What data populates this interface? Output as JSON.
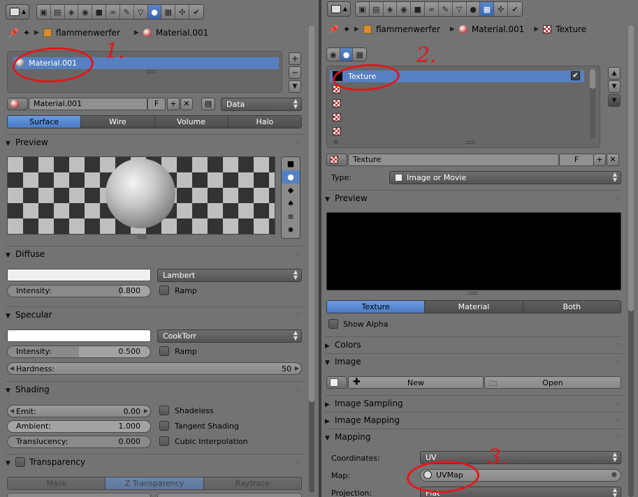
{
  "left": {
    "breadcrumb": {
      "object": "flammenwerfer",
      "material": "Material.001"
    },
    "slot_list": {
      "selected": "Material.001"
    },
    "datablock": {
      "name": "Material.001",
      "fake_user": "F",
      "link": "Data"
    },
    "tabs": [
      "Surface",
      "Wire",
      "Volume",
      "Halo"
    ],
    "preview": {
      "title": "Preview"
    },
    "diffuse": {
      "title": "Diffuse",
      "shader": "Lambert",
      "intensity_label": "Intensity:",
      "intensity_value": "0.800",
      "intensity": 0.8,
      "ramp": "Ramp",
      "color": "#f0f0f0"
    },
    "specular": {
      "title": "Specular",
      "shader": "CookTorr",
      "intensity_label": "Intensity:",
      "intensity_value": "0.500",
      "intensity": 0.5,
      "ramp": "Ramp",
      "hardness_label": "Hardness:",
      "hardness_value": "50",
      "color": "#ffffff"
    },
    "shading": {
      "title": "Shading",
      "emit_label": "Emit:",
      "emit_value": "0.00",
      "ambient_label": "Ambient:",
      "ambient_value": "1.000",
      "translucency_label": "Translucency:",
      "translucency_value": "0.000",
      "shadeless": "Shadeless",
      "tangent": "Tangent Shading",
      "cubic": "Cubic Interpolation"
    },
    "transparency": {
      "title": "Transparency",
      "tabs": [
        "Mask",
        "Z Transparency",
        "Raytrace"
      ]
    }
  },
  "right": {
    "breadcrumb": {
      "object": "flammenwerfer",
      "material": "Material.001",
      "texture": "Texture"
    },
    "slot_list": {
      "selected": "Texture"
    },
    "datablock": {
      "name": "Texture",
      "fake_user": "F"
    },
    "type": {
      "label": "Type:",
      "value": "Image or Movie"
    },
    "preview": {
      "title": "Preview",
      "tabs": [
        "Texture",
        "Material",
        "Both"
      ],
      "show_alpha": "Show Alpha"
    },
    "panels": {
      "colors": "Colors",
      "image": "Image",
      "image_sampling": "Image Sampling",
      "image_mapping": "Image Mapping",
      "mapping": "Mapping"
    },
    "image": {
      "new": "New",
      "open": "Open"
    },
    "mapping": {
      "coordinates_label": "Coordinates:",
      "coordinates_value": "UV",
      "map_label": "Map:",
      "map_value": "UVMap",
      "projection_label": "Projection:",
      "projection_value": "Flat"
    }
  },
  "annotations": [
    "1.",
    "2.",
    "3."
  ],
  "colors": {
    "accent": "#5680c2",
    "annotation": "#e5161a",
    "panel_bg": "#737373"
  }
}
